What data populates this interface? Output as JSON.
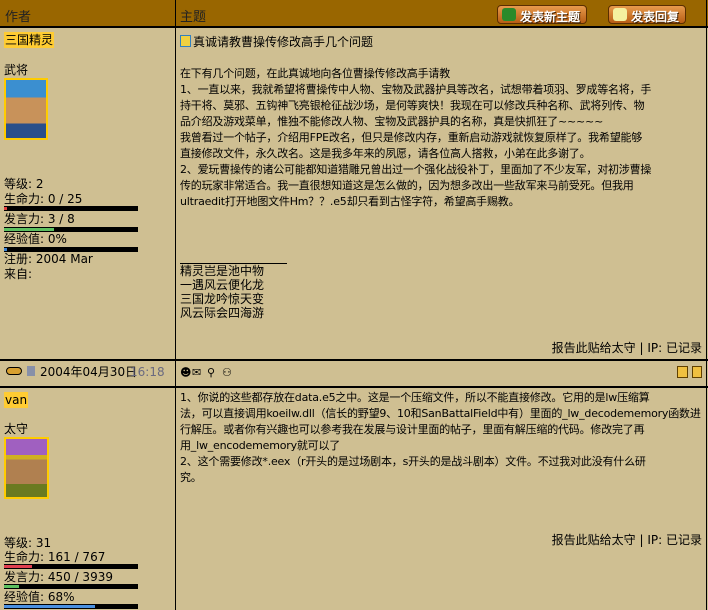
{
  "header": {
    "author_col": "作者",
    "topic_col": "主题",
    "new_topic_button": "发表新主题",
    "reply_button": "发表回复"
  },
  "posts": [
    {
      "author": "三国精灵",
      "rank": "武将",
      "stats": {
        "level": "等级: 2",
        "hp": "生命力: 0 / 25",
        "speech": "发言力: 3 / 8",
        "exp": "经验值: 0%",
        "registered": "注册: 2004 Mar",
        "from": "来自:"
      },
      "bars": {
        "hp": 0.02,
        "speech": 0.375,
        "exp": 0.02
      },
      "title": "真诚请教曹操传修改高手几个问题",
      "body": [
        "在下有几个问题，在此真诚地向各位曹操传修改高手请教",
        "1、一直以来，我就希望将曹操传中人物、宝物及武器护具等改名，试想带着项羽、罗成等名将，手",
        "持干将、莫邪、五钩神飞亮银枪征战沙场，是何等爽快！我现在可以修改兵种名称、武将列传、物",
        "品介绍及游戏菜单，惟独不能修改人物、宝物及武器护具的名称，真是快抓狂了~~~~~",
        "我曾看过一个帖子，介绍用FPE改名，但只是修改内存，重新启动游戏就恢复原样了。我希望能够",
        "直接修改文件，永久改名。这是我多年来的夙愿，请各位高人搭救，小弟在此多谢了。",
        "2、爱玩曹操传的诸公可能都知道猎雕兄曾出过一个强化战役补丁，里面加了不少友军，对初涉曹操",
        "传的玩家非常适合。我一直很想知道这是怎么做的，因为想多改出一些敌军来马前受死。但我用",
        "ultraedit打开地图文件Hm？？.e5却只看到古怪字符，希望高手赐教。"
      ],
      "signature": [
        "精灵岂是池中物",
        "一遇风云便化龙",
        "三国龙吟惊天变",
        "风云际会四海游"
      ],
      "report": "报告此贴给太守",
      "ip": "| IP: 已记录"
    },
    {
      "author": "van",
      "rank": "太守",
      "date": "2004年04月30日",
      "time": "16:18",
      "stats": {
        "level": "等级: 31",
        "hp": "生命力: 161 / 767",
        "speech": "发言力: 450 / 3939",
        "exp": "经验值: 68%"
      },
      "bars": {
        "hp": 0.21,
        "speech": 0.11,
        "exp": 0.68
      },
      "body": [
        "1、你说的这些都存放在data.e5之中。这是一个压缩文件，所以不能直接修改。它用的是lw压缩算",
        "法，可以直接调用koeilw.dll（信长的野望9、10和SanBattalField中有）里面的_lw_decodememory函数进",
        "行解压。或者你有兴趣也可以参考我在发展与设计里面的帖子，里面有解压缩的代码。修改完了再",
        "用_lw_encodememory就可以了",
        "2、这个需要修改*.eex（r开头的是过场剧本，s开头的是战斗剧本）文件。不过我对此没有什么研",
        "究。"
      ],
      "report": "报告此贴给太守",
      "ip": "| IP: 已记录"
    }
  ],
  "colors": {
    "header": "#996600",
    "body": "#cfbf92",
    "name_highlight": "#ffcc33"
  }
}
